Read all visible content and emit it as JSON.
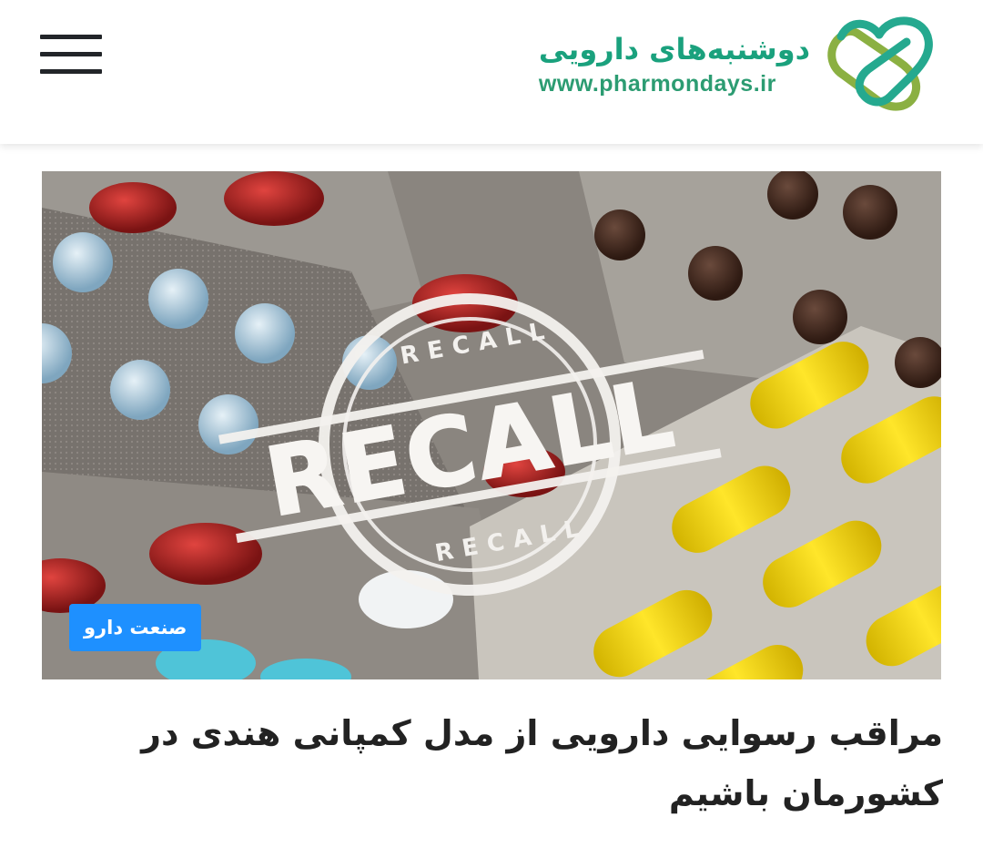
{
  "header": {
    "brand_name": "دوشنبه‌های دارویی",
    "brand_url": "www.pharmondays.ir",
    "menu_icon": "hamburger-menu-icon",
    "logo_icon": "pharmondays-logo-icon",
    "colors": {
      "brand_green": "#1aa17d",
      "logo_olive": "#8bb042",
      "logo_teal": "#25a98f"
    }
  },
  "hero": {
    "image_subject": "drug-recall-blister-packs",
    "stamp_text": "RECALL",
    "category_badge": "صنعت دارو",
    "badge_color": "#1e90ff"
  },
  "article": {
    "title": "مراقب رسوایی دارویی از مدل کمپانی هندی در کشورمان باشیم"
  }
}
